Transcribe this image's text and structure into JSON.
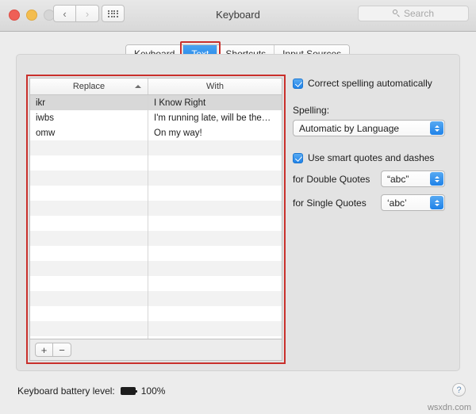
{
  "window": {
    "title": "Keyboard",
    "traffic_lights": [
      "close-red",
      "minimize-yellow",
      "zoom-disabled"
    ],
    "nav": {
      "back": "‹",
      "forward": "›"
    },
    "show_all_icon": "grid-icon"
  },
  "search": {
    "placeholder": "Search",
    "icon": "search-icon"
  },
  "tabs": [
    {
      "label": "Keyboard",
      "selected": false
    },
    {
      "label": "Text",
      "selected": true
    },
    {
      "label": "Shortcuts",
      "selected": false
    },
    {
      "label": "Input Sources",
      "selected": false
    }
  ],
  "table": {
    "columns": [
      {
        "label": "Replace",
        "sorted": "ascending",
        "sort_icon": "chevron-up-icon"
      },
      {
        "label": "With",
        "sorted": "none"
      }
    ],
    "rows": [
      {
        "replace": "ikr",
        "with": "I Know Right",
        "selected": true
      },
      {
        "replace": "iwbs",
        "with": "I'm running late, will be the…",
        "selected": false
      },
      {
        "replace": "omw",
        "with": "On my way!",
        "selected": false
      }
    ],
    "empty_row_count": 14,
    "add_button": "+",
    "remove_button": "−"
  },
  "options": {
    "correct_spelling": {
      "label": "Correct spelling automatically",
      "checked": true
    },
    "spelling_label": "Spelling:",
    "spelling_value": "Automatic by Language",
    "smart_quotes": {
      "label": "Use smart quotes and dashes",
      "checked": true
    },
    "double_quotes_label": "for Double Quotes",
    "double_quotes_value": "“abc”",
    "single_quotes_label": "for Single Quotes",
    "single_quotes_value": "‘abc’"
  },
  "status": {
    "battery_label": "Keyboard battery level:",
    "battery_icon": "battery-full-icon",
    "battery_percent": "100%",
    "help_button": "?"
  },
  "watermark": "wsxdn.com",
  "annotations": {
    "highlight_color": "#c9302c",
    "boxes": [
      "text-tab",
      "text-replacement-table"
    ]
  }
}
